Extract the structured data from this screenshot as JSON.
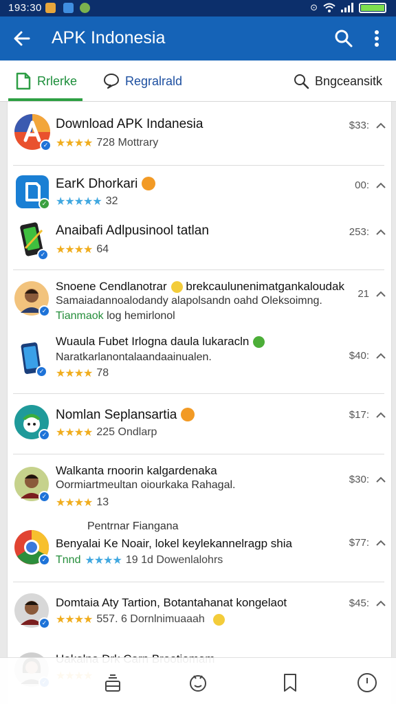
{
  "status_bar": {
    "time": "193:30"
  },
  "app_bar": {
    "title": "APK Indonesia"
  },
  "tabs": [
    {
      "label": "Rrlerke",
      "active": true
    },
    {
      "label": "Regralrald",
      "active": false
    },
    {
      "label": "Bngceansitk",
      "active": false
    }
  ],
  "items": [
    {
      "title": "Download APK Indanesia",
      "stars": "★★★★",
      "rating_text": "728  Mottrary",
      "price": "$33:"
    },
    {
      "title": "EarK Dhorkari",
      "stars": "★★★★★",
      "rating_text": "32",
      "price": "00:"
    },
    {
      "title": "Anaibafi Adlpusinool tatlan",
      "stars": "★★★★",
      "rating_text": "64",
      "price": "253:"
    },
    {
      "title": "Snoene Cendlanotrar",
      "title_rest": "brekcaulunenimatgankaloudak",
      "subtitle": "Samaiadannoalodandy alapolsandn oahd Oleksoimng.",
      "subtitle2": "Tianmaok",
      "subtitle2_rest": "log hemirlonol",
      "price": "21"
    },
    {
      "title": "Wuaula Fubet Irlogna daula lukaracln",
      "subtitle": "Naratkarlanontalaandaainualen.",
      "stars": "★★★★",
      "rating_text": "78",
      "price": "$40:"
    },
    {
      "title": "Nomlan Seplansartia",
      "stars": "★★★★",
      "rating_text": "225  Ondlarp",
      "price": "$17:"
    },
    {
      "title": "Walkanta rnoorin kalgardenaka",
      "subtitle": "Oormiartmeultan oiourkaka Rahagal.",
      "stars": "★★★★",
      "rating_text": "13",
      "price": "$30:"
    },
    {
      "floating_label": "Pentrnar Fiangana",
      "title": "Benyalai Ke Noair, lokel keylekannelragp shia",
      "stars": "★★★★",
      "stars_prefix": "Tnnd",
      "rating_text": "19 1d  Dowenlalohrs",
      "price": "$77:"
    },
    {
      "title": "Domtaia Aty Tartion, Botantahanat kongelaot",
      "stars": "★★★★",
      "rating_text": "557. 6  Dornlnimuaaah",
      "price": "$45:"
    },
    {
      "title": "Uakalna Drk Carn Brootiomam",
      "stars": "★★★★"
    }
  ]
}
